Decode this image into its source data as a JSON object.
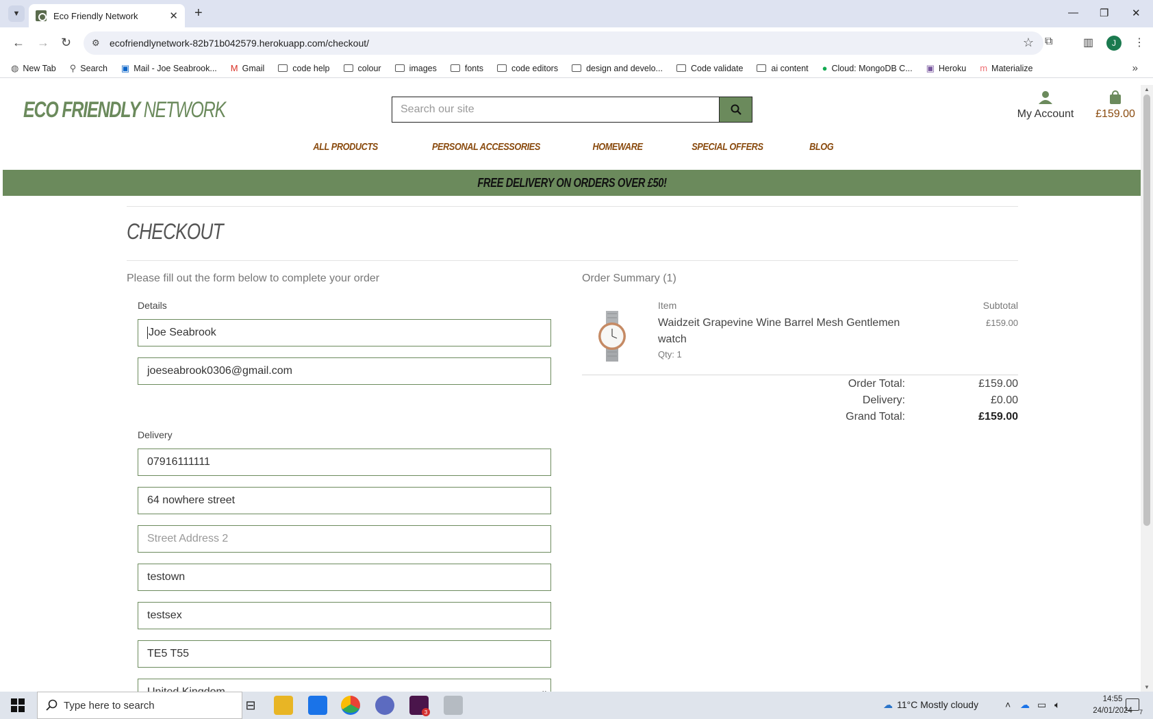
{
  "browser": {
    "tab_title": "Eco Friendly Network",
    "url": "ecofriendlynetwork-82b71b042579.herokuapp.com/checkout/",
    "profile_initial": "J",
    "bookmarks": [
      "New Tab",
      "Search",
      "Mail - Joe Seabrook...",
      "Gmail",
      "code help",
      "colour",
      "images",
      "fonts",
      "code editors",
      "design and develo...",
      "Code validate",
      "ai content",
      "Cloud: MongoDB C...",
      "Heroku",
      "Materialize"
    ]
  },
  "header": {
    "logo_part1": "ECO FRIENDLY",
    "logo_part2": " NETWORK",
    "search_placeholder": "Search our site",
    "account_label": "My Account",
    "bag_total": "£159.00"
  },
  "nav": [
    "ALL PRODUCTS",
    "PERSONAL ACCESSORIES",
    "HOMEWARE",
    "SPECIAL OFFERS",
    "BLOG"
  ],
  "banner": "FREE DELIVERY ON ORDERS OVER £50!",
  "checkout": {
    "title": "CHECKOUT",
    "intro": "Please fill out the form below to complete your order",
    "details_label": "Details",
    "full_name": "Joe Seabrook",
    "email": "joeseabrook0306@gmail.com",
    "delivery_label": "Delivery",
    "phone": "07916111111",
    "street1": "64 nowhere street",
    "street2_placeholder": "Street Address 2",
    "town": "testown",
    "county": "testsex",
    "postcode": "TE5 T55",
    "country": "United Kingdom"
  },
  "summary": {
    "title": "Order Summary (1)",
    "item_header": "Item",
    "subtotal_header": "Subtotal",
    "product_name": "Waidzeit Grapevine Wine Barrel Mesh Gentlemen watch",
    "product_qty": "Qty: 1",
    "product_subtotal": "£159.00",
    "order_total_label": "Order Total:",
    "order_total": "£159.00",
    "delivery_label": "Delivery:",
    "delivery": "£0.00",
    "grand_total_label": "Grand Total:",
    "grand_total": "£159.00"
  },
  "taskbar": {
    "search_placeholder": "Type here to search",
    "weather": "11°C  Mostly cloudy",
    "time": "14:55",
    "date": "24/01/2024",
    "slack_badge": "3",
    "notif_count": "7"
  },
  "colors": {
    "brand_green": "#6b8a5c",
    "brand_brown": "#8a4b0f"
  }
}
